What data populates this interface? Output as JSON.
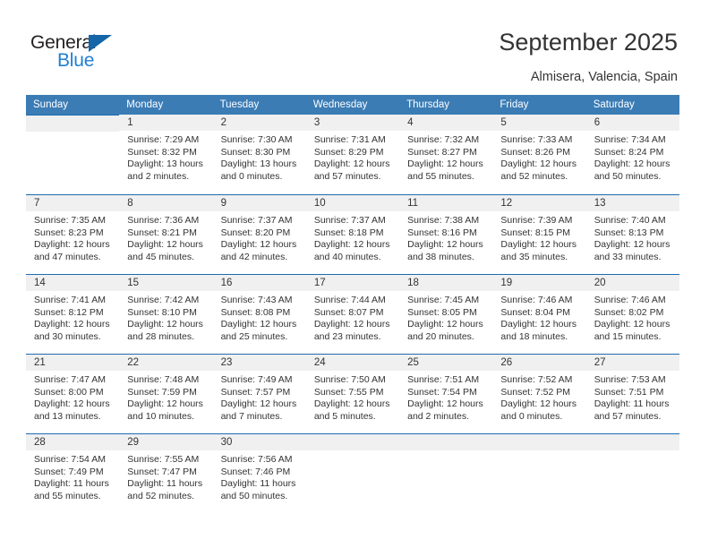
{
  "brand": {
    "name_top": "General",
    "name_bottom": "Blue",
    "color_dark": "#231f20",
    "color_blue": "#1f7fd4"
  },
  "header": {
    "title": "September 2025",
    "location": "Almisera, Valencia, Spain"
  },
  "theme": {
    "header_band": "#3b7cb5",
    "row_divider": "#1f6cb0",
    "daynum_band": "#f0f0f0",
    "text": "#333333"
  },
  "calendar": {
    "weekday_headers": [
      "Sunday",
      "Monday",
      "Tuesday",
      "Wednesday",
      "Thursday",
      "Friday",
      "Saturday"
    ],
    "weeks": [
      [
        {
          "day": "",
          "sunrise": "",
          "sunset": "",
          "daylight": "",
          "daylight2": ""
        },
        {
          "day": "1",
          "sunrise": "Sunrise: 7:29 AM",
          "sunset": "Sunset: 8:32 PM",
          "daylight": "Daylight: 13 hours",
          "daylight2": "and 2 minutes."
        },
        {
          "day": "2",
          "sunrise": "Sunrise: 7:30 AM",
          "sunset": "Sunset: 8:30 PM",
          "daylight": "Daylight: 13 hours",
          "daylight2": "and 0 minutes."
        },
        {
          "day": "3",
          "sunrise": "Sunrise: 7:31 AM",
          "sunset": "Sunset: 8:29 PM",
          "daylight": "Daylight: 12 hours",
          "daylight2": "and 57 minutes."
        },
        {
          "day": "4",
          "sunrise": "Sunrise: 7:32 AM",
          "sunset": "Sunset: 8:27 PM",
          "daylight": "Daylight: 12 hours",
          "daylight2": "and 55 minutes."
        },
        {
          "day": "5",
          "sunrise": "Sunrise: 7:33 AM",
          "sunset": "Sunset: 8:26 PM",
          "daylight": "Daylight: 12 hours",
          "daylight2": "and 52 minutes."
        },
        {
          "day": "6",
          "sunrise": "Sunrise: 7:34 AM",
          "sunset": "Sunset: 8:24 PM",
          "daylight": "Daylight: 12 hours",
          "daylight2": "and 50 minutes."
        }
      ],
      [
        {
          "day": "7",
          "sunrise": "Sunrise: 7:35 AM",
          "sunset": "Sunset: 8:23 PM",
          "daylight": "Daylight: 12 hours",
          "daylight2": "and 47 minutes."
        },
        {
          "day": "8",
          "sunrise": "Sunrise: 7:36 AM",
          "sunset": "Sunset: 8:21 PM",
          "daylight": "Daylight: 12 hours",
          "daylight2": "and 45 minutes."
        },
        {
          "day": "9",
          "sunrise": "Sunrise: 7:37 AM",
          "sunset": "Sunset: 8:20 PM",
          "daylight": "Daylight: 12 hours",
          "daylight2": "and 42 minutes."
        },
        {
          "day": "10",
          "sunrise": "Sunrise: 7:37 AM",
          "sunset": "Sunset: 8:18 PM",
          "daylight": "Daylight: 12 hours",
          "daylight2": "and 40 minutes."
        },
        {
          "day": "11",
          "sunrise": "Sunrise: 7:38 AM",
          "sunset": "Sunset: 8:16 PM",
          "daylight": "Daylight: 12 hours",
          "daylight2": "and 38 minutes."
        },
        {
          "day": "12",
          "sunrise": "Sunrise: 7:39 AM",
          "sunset": "Sunset: 8:15 PM",
          "daylight": "Daylight: 12 hours",
          "daylight2": "and 35 minutes."
        },
        {
          "day": "13",
          "sunrise": "Sunrise: 7:40 AM",
          "sunset": "Sunset: 8:13 PM",
          "daylight": "Daylight: 12 hours",
          "daylight2": "and 33 minutes."
        }
      ],
      [
        {
          "day": "14",
          "sunrise": "Sunrise: 7:41 AM",
          "sunset": "Sunset: 8:12 PM",
          "daylight": "Daylight: 12 hours",
          "daylight2": "and 30 minutes."
        },
        {
          "day": "15",
          "sunrise": "Sunrise: 7:42 AM",
          "sunset": "Sunset: 8:10 PM",
          "daylight": "Daylight: 12 hours",
          "daylight2": "and 28 minutes."
        },
        {
          "day": "16",
          "sunrise": "Sunrise: 7:43 AM",
          "sunset": "Sunset: 8:08 PM",
          "daylight": "Daylight: 12 hours",
          "daylight2": "and 25 minutes."
        },
        {
          "day": "17",
          "sunrise": "Sunrise: 7:44 AM",
          "sunset": "Sunset: 8:07 PM",
          "daylight": "Daylight: 12 hours",
          "daylight2": "and 23 minutes."
        },
        {
          "day": "18",
          "sunrise": "Sunrise: 7:45 AM",
          "sunset": "Sunset: 8:05 PM",
          "daylight": "Daylight: 12 hours",
          "daylight2": "and 20 minutes."
        },
        {
          "day": "19",
          "sunrise": "Sunrise: 7:46 AM",
          "sunset": "Sunset: 8:04 PM",
          "daylight": "Daylight: 12 hours",
          "daylight2": "and 18 minutes."
        },
        {
          "day": "20",
          "sunrise": "Sunrise: 7:46 AM",
          "sunset": "Sunset: 8:02 PM",
          "daylight": "Daylight: 12 hours",
          "daylight2": "and 15 minutes."
        }
      ],
      [
        {
          "day": "21",
          "sunrise": "Sunrise: 7:47 AM",
          "sunset": "Sunset: 8:00 PM",
          "daylight": "Daylight: 12 hours",
          "daylight2": "and 13 minutes."
        },
        {
          "day": "22",
          "sunrise": "Sunrise: 7:48 AM",
          "sunset": "Sunset: 7:59 PM",
          "daylight": "Daylight: 12 hours",
          "daylight2": "and 10 minutes."
        },
        {
          "day": "23",
          "sunrise": "Sunrise: 7:49 AM",
          "sunset": "Sunset: 7:57 PM",
          "daylight": "Daylight: 12 hours",
          "daylight2": "and 7 minutes."
        },
        {
          "day": "24",
          "sunrise": "Sunrise: 7:50 AM",
          "sunset": "Sunset: 7:55 PM",
          "daylight": "Daylight: 12 hours",
          "daylight2": "and 5 minutes."
        },
        {
          "day": "25",
          "sunrise": "Sunrise: 7:51 AM",
          "sunset": "Sunset: 7:54 PM",
          "daylight": "Daylight: 12 hours",
          "daylight2": "and 2 minutes."
        },
        {
          "day": "26",
          "sunrise": "Sunrise: 7:52 AM",
          "sunset": "Sunset: 7:52 PM",
          "daylight": "Daylight: 12 hours",
          "daylight2": "and 0 minutes."
        },
        {
          "day": "27",
          "sunrise": "Sunrise: 7:53 AM",
          "sunset": "Sunset: 7:51 PM",
          "daylight": "Daylight: 11 hours",
          "daylight2": "and 57 minutes."
        }
      ],
      [
        {
          "day": "28",
          "sunrise": "Sunrise: 7:54 AM",
          "sunset": "Sunset: 7:49 PM",
          "daylight": "Daylight: 11 hours",
          "daylight2": "and 55 minutes."
        },
        {
          "day": "29",
          "sunrise": "Sunrise: 7:55 AM",
          "sunset": "Sunset: 7:47 PM",
          "daylight": "Daylight: 11 hours",
          "daylight2": "and 52 minutes."
        },
        {
          "day": "30",
          "sunrise": "Sunrise: 7:56 AM",
          "sunset": "Sunset: 7:46 PM",
          "daylight": "Daylight: 11 hours",
          "daylight2": "and 50 minutes."
        },
        {
          "day": "",
          "sunrise": "",
          "sunset": "",
          "daylight": "",
          "daylight2": ""
        },
        {
          "day": "",
          "sunrise": "",
          "sunset": "",
          "daylight": "",
          "daylight2": ""
        },
        {
          "day": "",
          "sunrise": "",
          "sunset": "",
          "daylight": "",
          "daylight2": ""
        },
        {
          "day": "",
          "sunrise": "",
          "sunset": "",
          "daylight": "",
          "daylight2": ""
        }
      ]
    ]
  }
}
